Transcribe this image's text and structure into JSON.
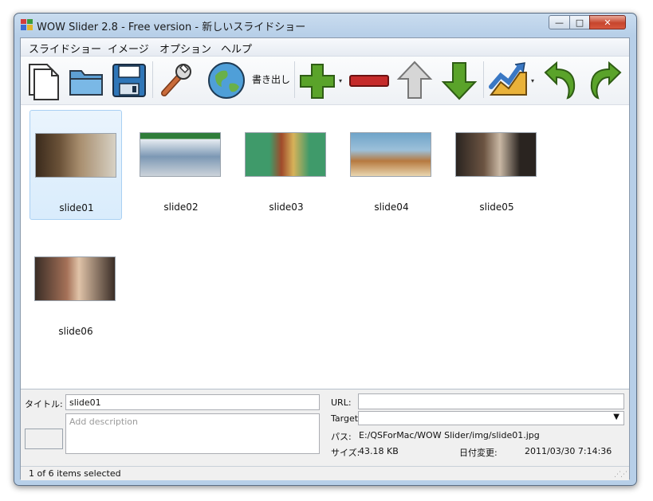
{
  "window": {
    "title": "WOW Slider 2.8 - Free version - 新しいスライドショー",
    "min_glyph": "—",
    "max_glyph": "□",
    "close_glyph": "✕"
  },
  "menu": {
    "items": [
      "スライドショー",
      "イメージ",
      "オプション",
      "ヘルプ"
    ]
  },
  "toolbar": {
    "export_label": "書き出し",
    "dropdown_glyph": "▾",
    "icons": [
      "new-document-icon",
      "open-folder-icon",
      "save-disk-icon",
      "wrench-icon",
      "globe-icon",
      "add-plus-icon",
      "remove-minus-icon",
      "move-up-arrow-icon",
      "move-down-arrow-icon",
      "chart-effect-icon",
      "undo-icon",
      "redo-icon"
    ],
    "accent_green": "#5aa32a",
    "accent_red": "#c52b2b"
  },
  "slides": [
    {
      "label": "slide01",
      "selected": true,
      "thumb_colors": [
        "#3a2a1c",
        "#a88e6e",
        "#d7d1c4"
      ]
    },
    {
      "label": "slide02",
      "selected": false,
      "thumb_colors": [
        "#2f7d3a",
        "#7c98b4",
        "#ccd3da"
      ]
    },
    {
      "label": "slide03",
      "selected": false,
      "thumb_colors": [
        "#3f9a6a",
        "#a04a2a",
        "#d7b25a"
      ]
    },
    {
      "label": "slide04",
      "selected": false,
      "thumb_colors": [
        "#6fa4c9",
        "#b6793f",
        "#e9d6b0"
      ]
    },
    {
      "label": "slide05",
      "selected": false,
      "thumb_colors": [
        "#2a2420",
        "#6c5442",
        "#c9b8a4"
      ]
    },
    {
      "label": "slide06",
      "selected": false,
      "thumb_colors": [
        "#3a2d26",
        "#a57158",
        "#e0c3a8"
      ]
    }
  ],
  "details": {
    "title_label": "タイトル:",
    "title_value": "slide01",
    "description_placeholder": "Add description",
    "url_label": "URL:",
    "url_value": "",
    "target_label": "Target",
    "target_value": "",
    "path_label": "パス:",
    "path_value": "E:/QSForMac/WOW Slider/img/slide01.jpg",
    "size_label": "サイズ:",
    "size_value": "43.18 KB",
    "date_label": "日付変更:",
    "date_value": "2011/03/30 7:14:36"
  },
  "status": {
    "text": "1 of 6 items selected"
  }
}
